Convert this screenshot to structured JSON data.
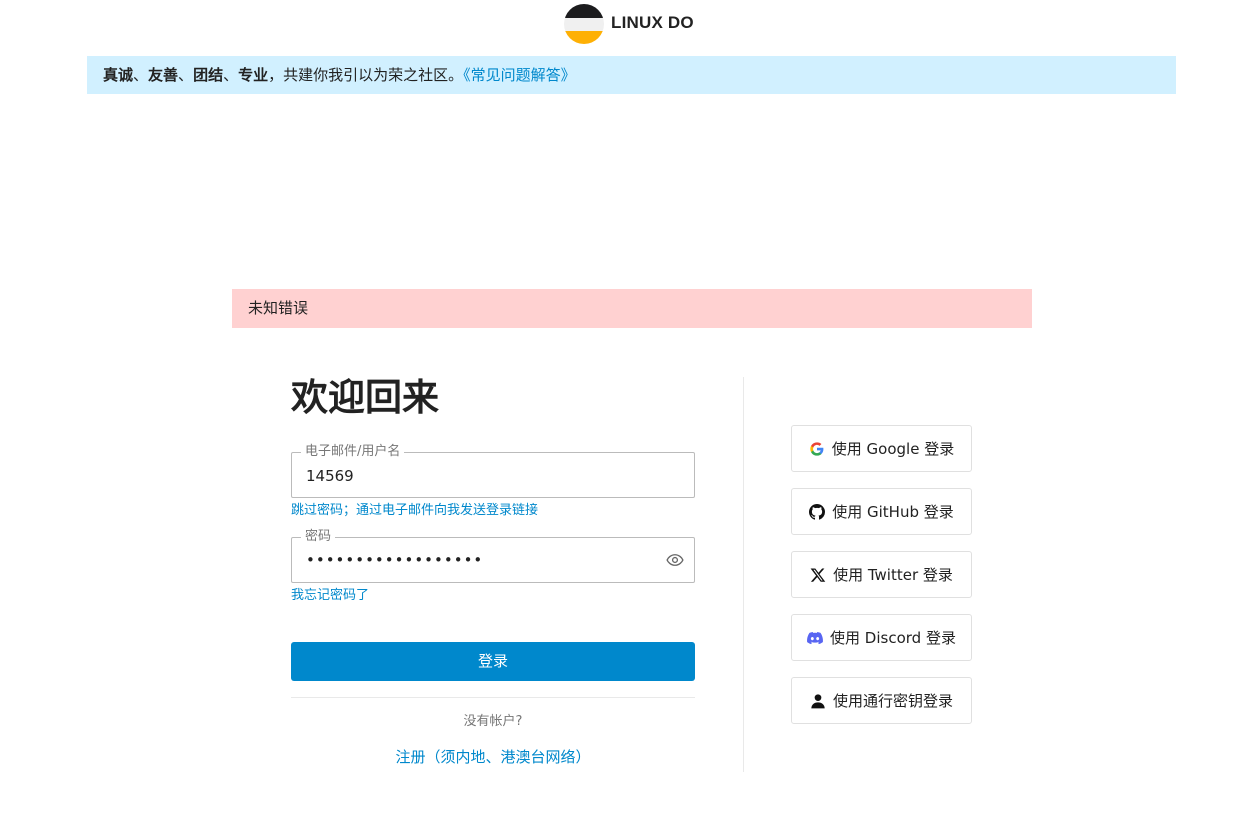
{
  "header": {
    "site_name": "LINUX DO"
  },
  "banner": {
    "v1": "真诚",
    "sep1": "、",
    "v2": "友善",
    "sep2": "、",
    "v3": "团结",
    "sep3": "、",
    "v4": "专业",
    "rest": "，共建你我引以为荣之社区。",
    "faq_link": "《常见问题解答》"
  },
  "alert": {
    "error_text": "未知错误"
  },
  "login": {
    "title": "欢迎回来",
    "username_label": "电子邮件/用户名",
    "username_value": "14569",
    "email_link": "跳过密码；通过电子邮件向我发送登录链接",
    "password_label": "密码",
    "password_mask": "••••••••••••••••••",
    "forgot_link": "我忘记密码了",
    "submit_label": "登录",
    "no_account": "没有帐户?",
    "signup_link": "注册（须内地、港澳台网络）"
  },
  "sso": {
    "google": "使用 Google 登录",
    "github": "使用 GitHub 登录",
    "twitter": "使用 Twitter 登录",
    "discord": "使用 Discord 登录",
    "passkey": "使用通行密钥登录"
  },
  "colors": {
    "accent": "#0088cc",
    "banner_bg": "#d1f0ff",
    "error_bg": "#ffd1d1",
    "discord": "#5865f2"
  }
}
